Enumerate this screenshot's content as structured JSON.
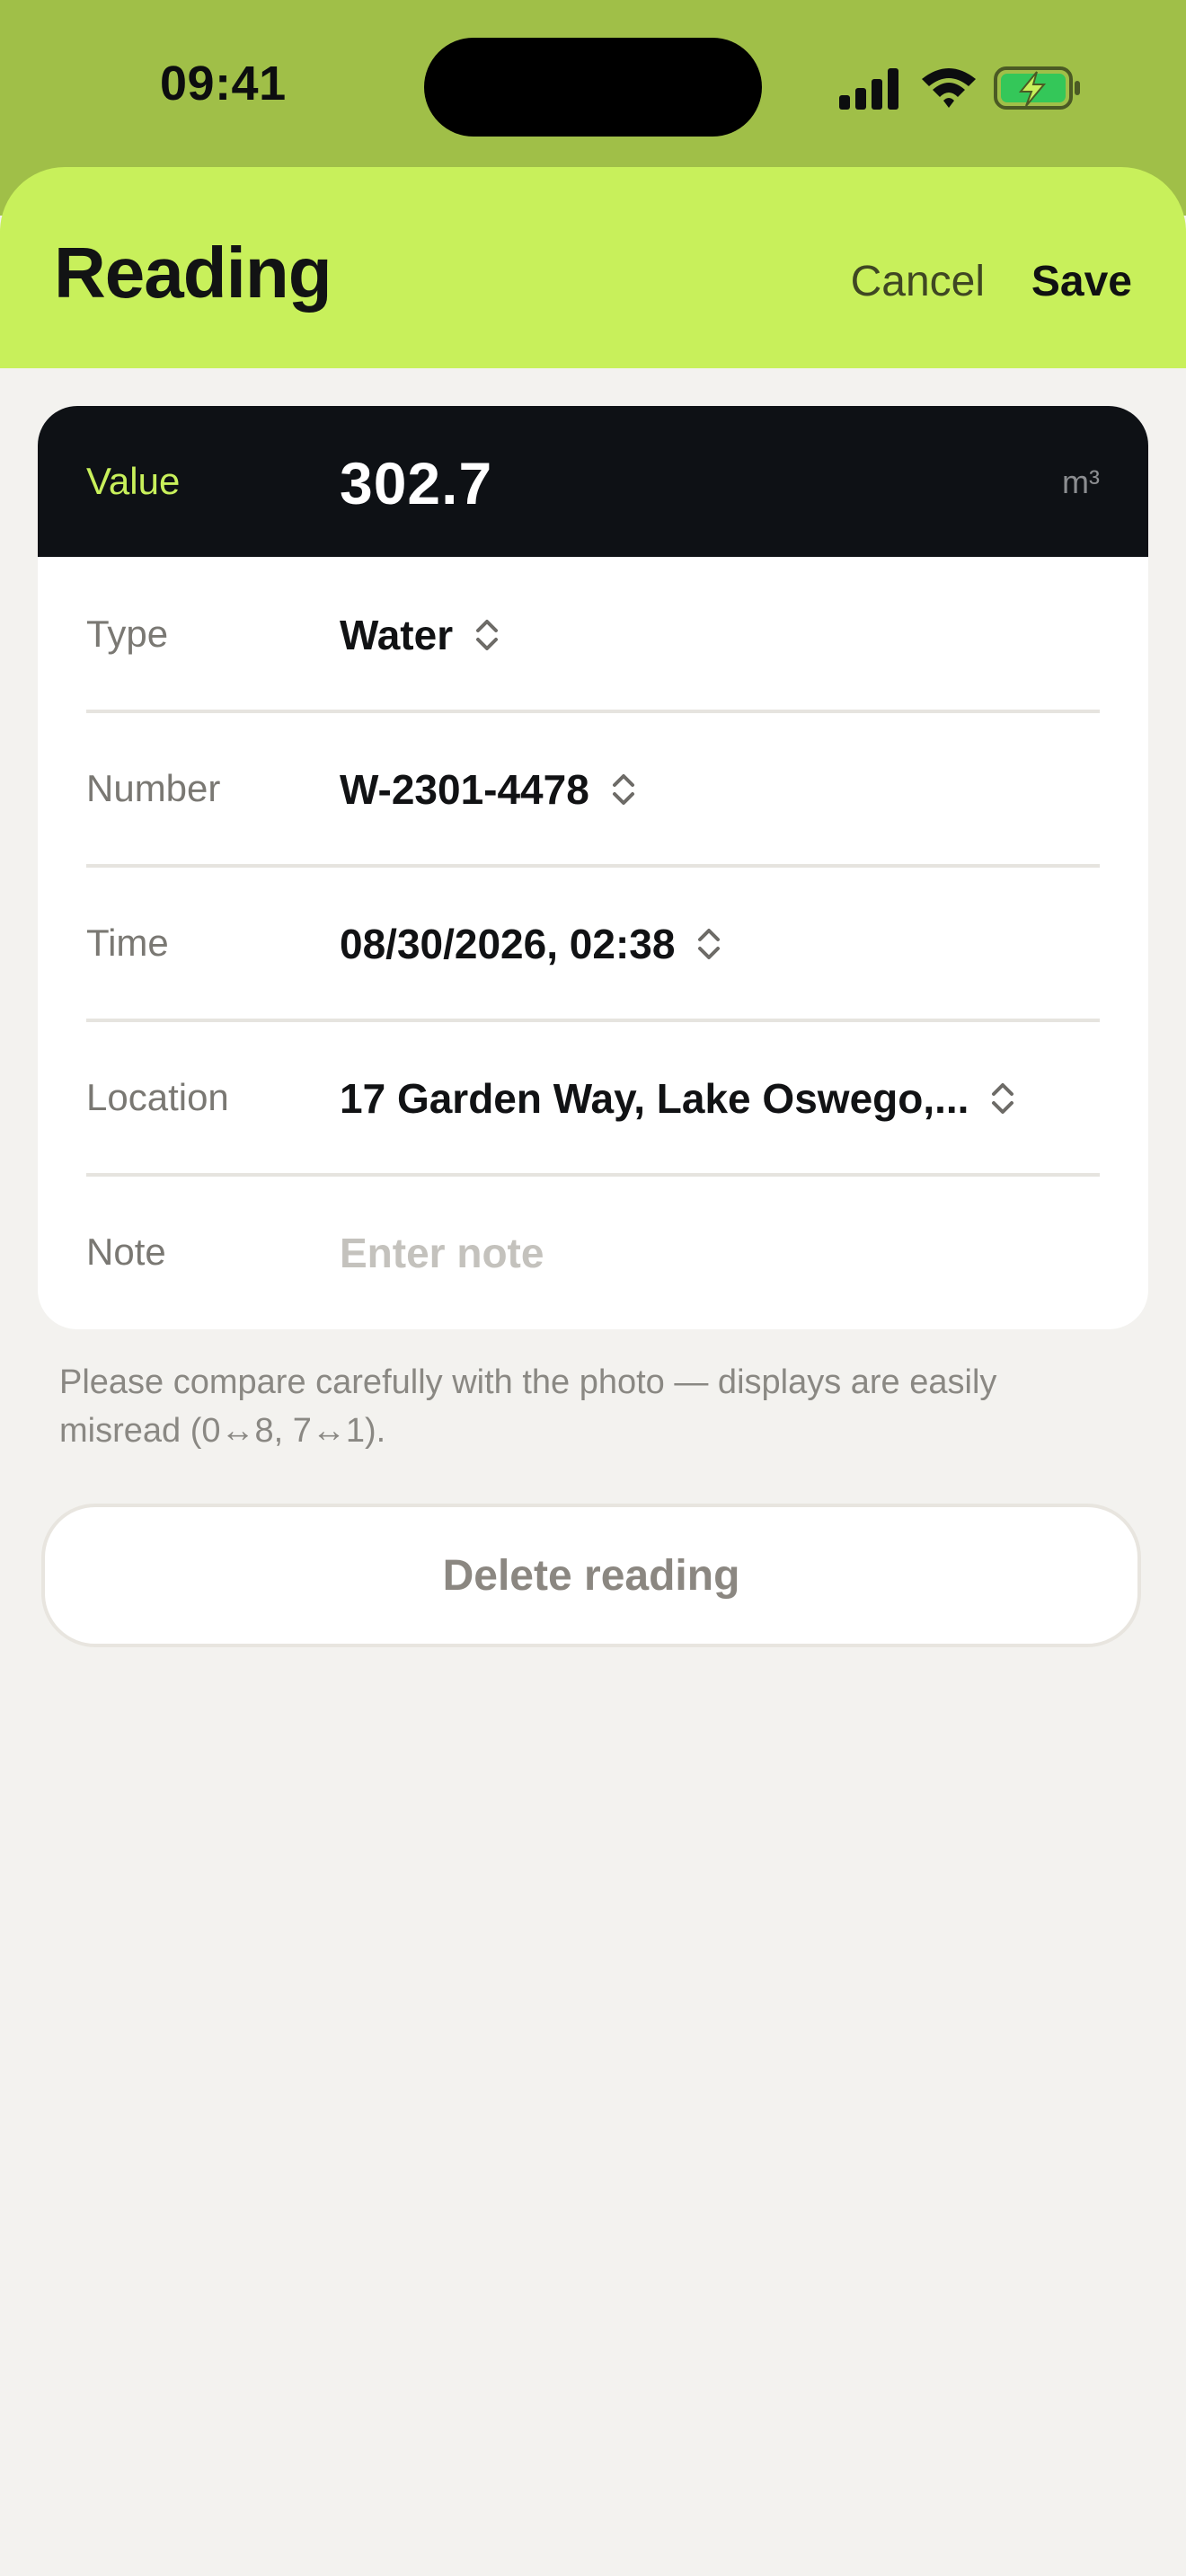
{
  "status_bar": {
    "time": "09:41"
  },
  "header": {
    "title": "Reading",
    "cancel_label": "Cancel",
    "save_label": "Save"
  },
  "value_row": {
    "label": "Value",
    "value": "302.7",
    "unit": "m³"
  },
  "fields": {
    "type": {
      "label": "Type",
      "value": "Water"
    },
    "number": {
      "label": "Number",
      "value": "W-2301-4478"
    },
    "time": {
      "label": "Time",
      "value": "08/30/2026, 02:38"
    },
    "location": {
      "label": "Location",
      "value": "17 Garden Way, Lake Oswego,..."
    },
    "note": {
      "label": "Note",
      "placeholder": "Enter note",
      "value": ""
    }
  },
  "hint": "Please compare carefully with the photo — displays are easily misread (0↔8, 7↔1).",
  "delete_label": "Delete reading",
  "colors": {
    "status_bg": "#a0bf48",
    "header_bg": "#c8f05b",
    "value_bg": "#0e1115",
    "accent": "#c8f05b",
    "battery_fill": "#34c759"
  }
}
